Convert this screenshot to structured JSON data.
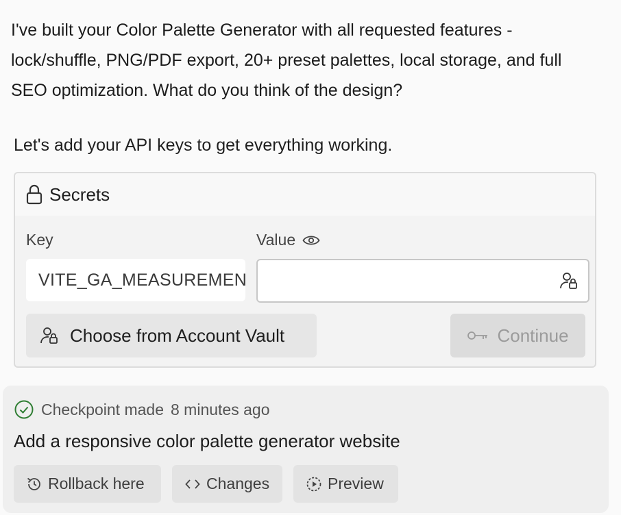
{
  "message": {
    "text": "I've built your Color Palette Generator with all requested features - lock/shuffle, PNG/PDF export, 20+ preset palettes, local storage, and full SEO optimization. What do you think of the design?"
  },
  "secrets_prompt": "Let's add your API keys to get everything working.",
  "secrets": {
    "title": "Secrets",
    "key_label": "Key",
    "value_label": "Value",
    "key_value": "VITE_GA_MEASUREMENT_ID",
    "value_value": "",
    "vault_button_label": "Choose from Account Vault",
    "continue_button_label": "Continue"
  },
  "checkpoint": {
    "status": "Checkpoint made",
    "time": "8 minutes ago",
    "title": "Add a responsive color palette generator website",
    "buttons": {
      "rollback": "Rollback here",
      "changes": "Changes",
      "preview": "Preview"
    }
  },
  "colors": {
    "success": "#2e7d32",
    "disabled_text": "#9b9b9b"
  },
  "icons": [
    "lock-icon",
    "eye-icon",
    "account-vault-icon",
    "key-icon",
    "check-circle-icon",
    "history-icon",
    "code-icon",
    "preview-icon"
  ]
}
